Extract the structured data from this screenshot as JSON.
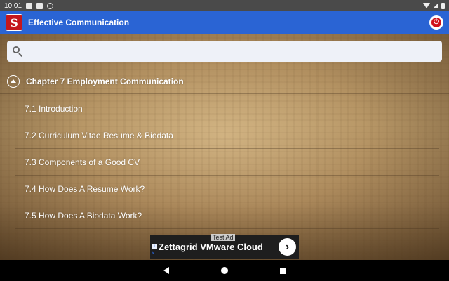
{
  "status_bar": {
    "time": "10:01"
  },
  "app_bar": {
    "logo_text": "S",
    "title": "Effective Communication",
    "power_symbol": "⏻"
  },
  "search": {
    "value": "",
    "placeholder": ""
  },
  "chapter": {
    "label": "Chapter 7 Employment Communication",
    "expanded": true
  },
  "topics": [
    {
      "label": "7.1 Introduction"
    },
    {
      "label": "7.2 Curriculum Vitae Resume & Biodata"
    },
    {
      "label": "7.3 Components of a Good CV"
    },
    {
      "label": "7.4 How Does A Resume Work?"
    },
    {
      "label": "7.5 How Does A Biodata Work?"
    }
  ],
  "ad": {
    "tag": "Test Ad",
    "text": "Zettagrid VMware Cloud",
    "arrow": "›"
  },
  "colors": {
    "app_bar": "#2a64d4",
    "logo": "#c4161c",
    "power": "#d0101a"
  }
}
